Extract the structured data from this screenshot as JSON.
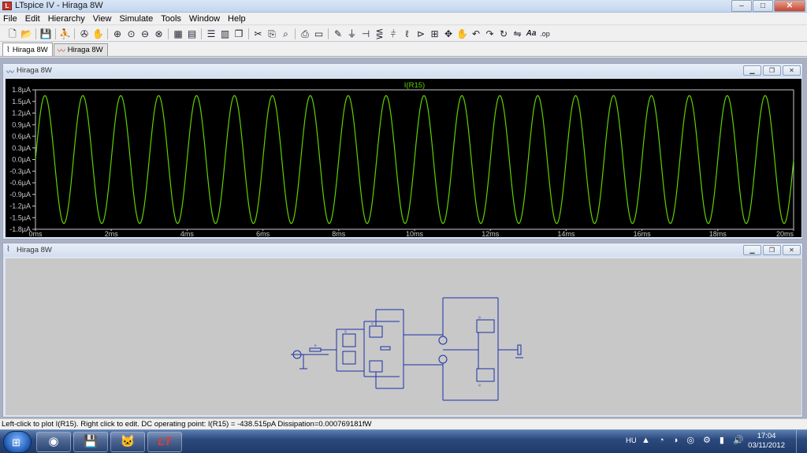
{
  "window": {
    "title": "LTspice IV - Hiraga 8W",
    "minimize": "–",
    "maximize": "□",
    "close": "✕"
  },
  "menu": [
    "File",
    "Edit",
    "Hierarchy",
    "View",
    "Simulate",
    "Tools",
    "Window",
    "Help"
  ],
  "toolbar": {
    "groups": [
      [
        "new-schematic",
        "open",
        "save"
      ],
      [
        "run",
        "halt",
        "pan"
      ],
      [
        "zoom-in",
        "zoom-out",
        "zoom-fit",
        "zoom-cancel"
      ],
      [
        "autorange",
        "plot-settings"
      ],
      [
        "tile-horizontal",
        "tile-vertical",
        "cascade"
      ],
      [
        "cut",
        "copy",
        "find"
      ],
      [
        "print",
        "print-preview"
      ],
      [
        "wire",
        "ground",
        "label",
        "resistor",
        "capacitor",
        "inductor",
        "diode",
        "component",
        "move",
        "drag",
        "undo",
        "redo",
        "rotate",
        "mirror",
        "text",
        "spice-directive"
      ]
    ],
    "text_icon": "Aa",
    "op_icon": ".op"
  },
  "tabs": [
    {
      "label": "Hiraga 8W",
      "icon": "schematic-icon",
      "active": true
    },
    {
      "label": "Hiraga 8W",
      "icon": "waveform-icon",
      "active": false
    }
  ],
  "plot_window": {
    "title": "Hiraga 8W",
    "trace_color": "#5fd200"
  },
  "chart_data": {
    "type": "line",
    "title": "I(R15)",
    "xlabel": "",
    "ylabel": "",
    "x_ticks": [
      "0ms",
      "2ms",
      "4ms",
      "6ms",
      "8ms",
      "10ms",
      "12ms",
      "14ms",
      "16ms",
      "18ms",
      "20ms"
    ],
    "y_ticks": [
      "1.8µA",
      "1.5µA",
      "1.2µA",
      "0.9µA",
      "0.6µA",
      "0.3µA",
      "0.0µA",
      "-0.3µA",
      "-0.6µA",
      "-0.9µA",
      "-1.2µA",
      "-1.5µA",
      "-1.8µA"
    ],
    "xlim": [
      0,
      20
    ],
    "ylim": [
      -1.8,
      1.8
    ],
    "x_unit": "ms",
    "y_unit": "µA",
    "series": [
      {
        "name": "I(R15)",
        "color": "#5fd200",
        "waveform": "sine",
        "amplitude": 1.65,
        "frequency_khz": 1.0,
        "cycles": 20
      }
    ],
    "grid": false
  },
  "schematic_window": {
    "title": "Hiraga 8W"
  },
  "status": "Left-click to plot I(R15).  Right click to edit.  DC operating point: I(R15) = -438.515pA   Dissipation=0.000769181fW",
  "taskbar": {
    "start_icon": "windows-logo",
    "apps": [
      "chrome",
      "save-app",
      "foobar-cat",
      "ltspice"
    ],
    "language": "HU",
    "time": "17:04",
    "date": "03/11/2012"
  }
}
